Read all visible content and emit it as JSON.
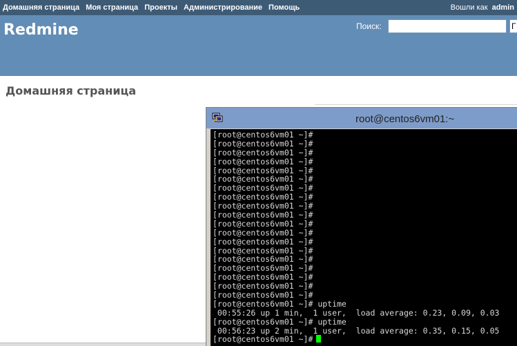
{
  "top_menu": {
    "items": [
      "Домашняя страница",
      "Моя страница",
      "Проекты",
      "Администрирование",
      "Помощь"
    ],
    "logged_as_label": "Вошли как",
    "logged_as_user": "admin"
  },
  "header": {
    "site_title": "Redmine",
    "search_label": "Поиск:",
    "search_value": "",
    "project_select_value": "Г"
  },
  "main": {
    "title": "Домашняя страница"
  },
  "terminal": {
    "title": "root@centos6vm01:~",
    "lines": [
      "[root@centos6vm01 ~]#",
      "[root@centos6vm01 ~]#",
      "[root@centos6vm01 ~]#",
      "[root@centos6vm01 ~]#",
      "[root@centos6vm01 ~]#",
      "[root@centos6vm01 ~]#",
      "[root@centos6vm01 ~]#",
      "[root@centos6vm01 ~]#",
      "[root@centos6vm01 ~]#",
      "[root@centos6vm01 ~]#",
      "[root@centos6vm01 ~]#",
      "[root@centos6vm01 ~]#",
      "[root@centos6vm01 ~]#",
      "[root@centos6vm01 ~]#",
      "[root@centos6vm01 ~]#",
      "[root@centos6vm01 ~]#",
      "[root@centos6vm01 ~]#",
      "[root@centos6vm01 ~]#",
      "[root@centos6vm01 ~]#",
      "[root@centos6vm01 ~]# uptime",
      " 00:55:26 up 1 min,  1 user,  load average: 0.23, 0.09, 0.03",
      "[root@centos6vm01 ~]# uptime",
      " 00:56:23 up 2 min,  1 user,  load average: 0.35, 0.15, 0.05",
      "[root@centos6vm01 ~]#"
    ],
    "cursor_color": "#00ff00",
    "background": "#000000",
    "foreground": "#d8d8d8"
  },
  "icons": {
    "terminal_app": "putty-icon"
  },
  "colors": {
    "top_menu_bg": "#3e5b76",
    "header_bg": "#628db6",
    "title_bar": "#7e9cc9"
  }
}
